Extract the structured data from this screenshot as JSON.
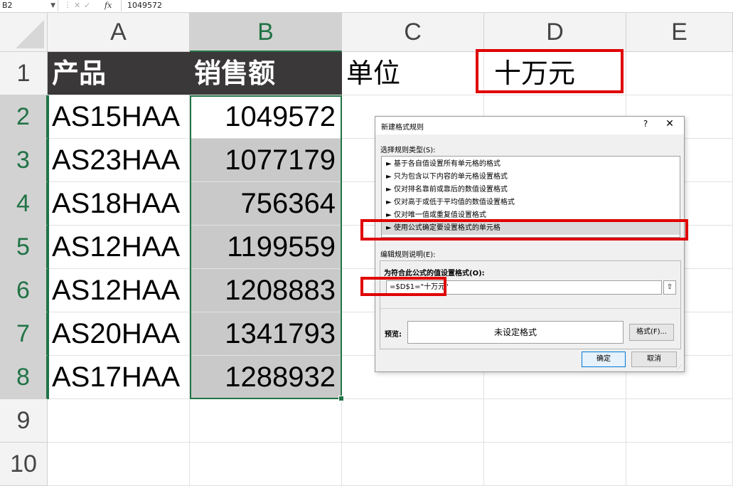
{
  "formula_bar": {
    "name_box": "B2",
    "fx_label": "fx",
    "value": "1049572"
  },
  "columns": [
    "A",
    "B",
    "C",
    "D",
    "E"
  ],
  "rows": [
    "1",
    "2",
    "3",
    "4",
    "5",
    "6",
    "7",
    "8",
    "9",
    "10"
  ],
  "cells": {
    "A1": "产品",
    "B1": "销售额",
    "C1": "单位",
    "D1": "十万元",
    "A2": "AS15HAA",
    "B2": "1049572",
    "A3": "AS23HAA",
    "B3": "1077179",
    "A4": "AS18HAA",
    "B4": "756364",
    "A5": "AS12HAA",
    "B5": "1199559",
    "A6": "AS12HAA",
    "B6": "1208883",
    "A7": "AS20HAA",
    "B7": "1341793",
    "A8": "AS17HAA",
    "B8": "1288932"
  },
  "dialog": {
    "title": "新建格式规则",
    "help": "?",
    "close": "✕",
    "rule_type_label": "选择规则类型(S):",
    "rule_types": [
      "► 基于各自值设置所有单元格的格式",
      "► 只为包含以下内容的单元格设置格式",
      "► 仅对排名靠前或靠后的数值设置格式",
      "► 仅对高于或低于平均值的数值设置格式",
      "► 仅对唯一值或重复值设置格式",
      "► 使用公式确定要设置格式的单元格"
    ],
    "selected_rule_index": 5,
    "edit_desc_label": "编辑规则说明(E):",
    "formula_label": "为符合此公式的值设置格式(O):",
    "formula_value": "=$D$1=\"十万元\"",
    "collapse_icon": "⇧",
    "preview_label": "预览:",
    "preview_text": "未设定格式",
    "format_button": "格式(F)...",
    "ok_button": "确定",
    "cancel_button": "取消"
  },
  "colors": {
    "header_fill": "#3a3838",
    "selection_green": "#217346",
    "highlight_red": "#e00000",
    "gray_fill": "#c9c9c9"
  }
}
